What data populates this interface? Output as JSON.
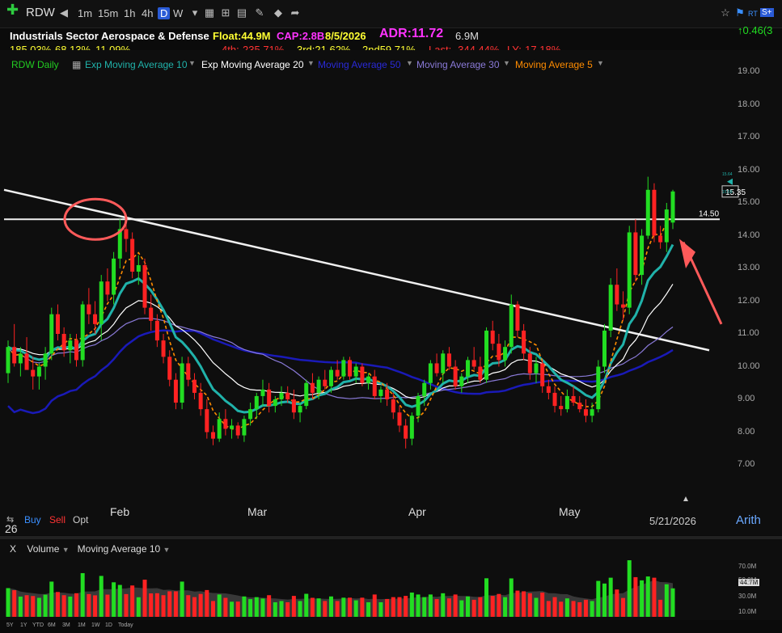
{
  "toolbar": {
    "symbol": "RDW",
    "intervals": [
      "1m",
      "15m",
      "1h",
      "4h",
      "D",
      "W"
    ],
    "selected_interval": "D",
    "right_change": "0.46(3",
    "rt_label": "RT",
    "s_label": "S+"
  },
  "info": {
    "sector": "Industrials Sector",
    "industry": "Aerospace & Defense",
    "float": "Float:44.9M",
    "cap": "CAP:2.8B",
    "earnings_date": "8/5/2026",
    "adr": "ADR:11.72",
    "avg_vol": "6.9M",
    "perf1": "185.03%",
    "perf2": "68.13%",
    "perf3": "11.09%",
    "q4": "4th:-235.71%",
    "q3": "3rd:21.62%",
    "q2": "2nd59.71%",
    "last": "Last: -344.44%",
    "ly": "LY:-17.18%"
  },
  "legend": {
    "daily": "RDW Daily",
    "ema10": "Exp Moving Average 10",
    "ema20": "Exp Moving Average 20",
    "ma50": "Moving Average 50",
    "ma30": "Moving Average 30",
    "ma5": "Moving Average 5"
  },
  "colors": {
    "up": "#22dd22",
    "down": "#ff2222",
    "ema10": "#20b2aa",
    "ema20": "#ffffff",
    "ma50": "#1a1ab8",
    "ma30": "#8a7ad8",
    "ma5": "#ff8c00",
    "daily": "#22cc22"
  },
  "chart_data": {
    "type": "candlestick",
    "y_ticks": [
      "19.00",
      "18.00",
      "17.00",
      "16.00",
      "15.00",
      "14.00",
      "13.00",
      "12.00",
      "11.00",
      "10.00",
      "9.00",
      "8.00",
      "7.00"
    ],
    "ylim": [
      6.5,
      19.5
    ],
    "x_ticks": [
      "Feb",
      "Mar",
      "Apr",
      "May"
    ],
    "date_label": "5/21/2026",
    "last_price": "15.35",
    "horizontal_line_label": "14.50",
    "horizontal_line_value": 14.5,
    "small_labels": [
      "15.64",
      "15.59"
    ],
    "candles": [
      [
        9.8,
        10.8,
        9.5,
        10.6
      ],
      [
        10.6,
        11.3,
        10.0,
        10.1
      ],
      [
        10.1,
        10.6,
        9.7,
        10.4
      ],
      [
        10.4,
        10.9,
        10.0,
        9.9
      ],
      [
        9.9,
        10.3,
        9.3,
        9.7
      ],
      [
        9.7,
        10.1,
        9.3,
        10.0
      ],
      [
        10.0,
        10.6,
        9.6,
        10.4
      ],
      [
        10.4,
        11.8,
        10.2,
        11.6
      ],
      [
        11.6,
        11.9,
        10.8,
        11.0
      ],
      [
        11.0,
        11.2,
        10.3,
        10.5
      ],
      [
        10.5,
        11.0,
        10.1,
        10.8
      ],
      [
        10.8,
        11.0,
        10.0,
        10.2
      ],
      [
        10.2,
        12.0,
        10.0,
        11.9
      ],
      [
        11.9,
        12.4,
        11.3,
        11.6
      ],
      [
        11.6,
        12.0,
        11.0,
        11.3
      ],
      [
        11.3,
        12.8,
        10.8,
        12.6
      ],
      [
        12.6,
        13.0,
        12.0,
        12.2
      ],
      [
        12.2,
        13.5,
        11.9,
        13.3
      ],
      [
        13.3,
        14.5,
        13.0,
        14.2
      ],
      [
        14.2,
        14.6,
        13.5,
        13.9
      ],
      [
        13.9,
        14.1,
        12.7,
        12.9
      ],
      [
        12.9,
        13.4,
        12.5,
        13.1
      ],
      [
        13.1,
        13.3,
        11.6,
        11.8
      ],
      [
        11.8,
        12.2,
        11.1,
        11.4
      ],
      [
        11.4,
        11.6,
        10.6,
        10.8
      ],
      [
        10.8,
        11.0,
        10.1,
        10.3
      ],
      [
        10.3,
        10.5,
        9.4,
        9.6
      ],
      [
        9.6,
        9.8,
        8.7,
        8.9
      ],
      [
        8.9,
        10.3,
        8.7,
        10.1
      ],
      [
        10.1,
        10.3,
        9.4,
        9.6
      ],
      [
        9.6,
        9.8,
        9.0,
        9.2
      ],
      [
        9.2,
        9.5,
        8.5,
        8.7
      ],
      [
        8.7,
        9.0,
        7.8,
        8.0
      ],
      [
        8.0,
        8.2,
        7.6,
        7.8
      ],
      [
        7.8,
        8.6,
        7.7,
        8.4
      ],
      [
        8.4,
        8.7,
        7.9,
        8.1
      ],
      [
        8.1,
        8.4,
        7.8,
        8.2
      ],
      [
        8.2,
        8.3,
        7.8,
        7.9
      ],
      [
        7.9,
        8.5,
        7.7,
        8.4
      ],
      [
        8.4,
        8.9,
        8.2,
        8.7
      ],
      [
        8.7,
        9.2,
        8.4,
        9.1
      ],
      [
        9.1,
        9.6,
        8.8,
        9.3
      ],
      [
        9.3,
        9.5,
        8.6,
        8.8
      ],
      [
        8.8,
        9.1,
        8.6,
        9.0
      ],
      [
        9.0,
        9.4,
        8.8,
        9.2
      ],
      [
        9.2,
        9.4,
        8.9,
        9.0
      ],
      [
        9.0,
        9.3,
        8.4,
        8.6
      ],
      [
        8.6,
        8.9,
        8.3,
        8.8
      ],
      [
        8.8,
        9.6,
        8.7,
        9.5
      ],
      [
        9.5,
        9.8,
        9.0,
        9.2
      ],
      [
        9.2,
        9.7,
        9.0,
        9.6
      ],
      [
        9.6,
        9.9,
        9.3,
        9.4
      ],
      [
        9.4,
        10.0,
        9.2,
        9.9
      ],
      [
        9.9,
        10.2,
        9.6,
        9.7
      ],
      [
        9.7,
        10.3,
        9.6,
        10.2
      ],
      [
        10.2,
        10.3,
        9.6,
        9.7
      ],
      [
        9.7,
        10.1,
        9.5,
        10.0
      ],
      [
        10.0,
        10.1,
        9.4,
        9.5
      ],
      [
        9.5,
        9.8,
        9.3,
        9.7
      ],
      [
        9.7,
        9.9,
        9.0,
        9.1
      ],
      [
        9.1,
        9.4,
        8.9,
        9.3
      ],
      [
        9.3,
        9.5,
        8.8,
        9.0
      ],
      [
        9.0,
        9.2,
        8.4,
        8.6
      ],
      [
        8.6,
        8.8,
        8.0,
        8.2
      ],
      [
        8.2,
        8.4,
        7.5,
        7.8
      ],
      [
        7.8,
        8.6,
        7.6,
        8.5
      ],
      [
        8.5,
        9.2,
        8.3,
        9.1
      ],
      [
        9.1,
        9.6,
        8.8,
        9.5
      ],
      [
        9.5,
        10.2,
        9.3,
        10.1
      ],
      [
        10.1,
        10.4,
        9.7,
        9.8
      ],
      [
        9.8,
        10.5,
        9.5,
        10.4
      ],
      [
        10.4,
        10.6,
        9.9,
        10.0
      ],
      [
        10.0,
        10.2,
        9.3,
        9.4
      ],
      [
        9.4,
        9.8,
        9.2,
        9.7
      ],
      [
        9.7,
        10.3,
        9.5,
        10.2
      ],
      [
        10.2,
        10.6,
        9.9,
        10.0
      ],
      [
        10.0,
        10.3,
        9.5,
        9.6
      ],
      [
        9.6,
        11.2,
        9.5,
        11.1
      ],
      [
        11.1,
        11.4,
        10.5,
        10.7
      ],
      [
        10.7,
        11.0,
        10.0,
        10.2
      ],
      [
        10.2,
        10.8,
        10.0,
        10.6
      ],
      [
        10.6,
        12.2,
        10.4,
        11.9
      ],
      [
        11.9,
        12.0,
        10.9,
        11.1
      ],
      [
        11.1,
        11.3,
        10.2,
        10.4
      ],
      [
        10.4,
        10.6,
        9.6,
        9.8
      ],
      [
        9.8,
        10.3,
        9.5,
        10.1
      ],
      [
        10.1,
        10.2,
        9.2,
        9.4
      ],
      [
        9.4,
        9.6,
        9.0,
        9.2
      ],
      [
        9.2,
        9.4,
        8.6,
        8.8
      ],
      [
        8.8,
        9.1,
        8.5,
        8.7
      ],
      [
        8.7,
        9.3,
        8.6,
        9.1
      ],
      [
        9.1,
        9.4,
        8.8,
        8.9
      ],
      [
        8.9,
        9.1,
        8.6,
        8.7
      ],
      [
        8.7,
        9.0,
        8.3,
        8.5
      ],
      [
        8.5,
        8.9,
        8.3,
        8.7
      ],
      [
        8.7,
        10.2,
        8.6,
        10.0
      ],
      [
        10.0,
        11.3,
        9.8,
        11.1
      ],
      [
        11.1,
        12.7,
        10.9,
        12.5
      ],
      [
        12.5,
        13.0,
        11.7,
        11.9
      ],
      [
        11.9,
        12.3,
        11.4,
        11.8
      ],
      [
        11.8,
        14.3,
        11.6,
        14.1
      ],
      [
        14.1,
        14.5,
        12.6,
        12.8
      ],
      [
        12.8,
        14.2,
        12.5,
        14.0
      ],
      [
        14.0,
        15.8,
        13.9,
        15.4
      ],
      [
        15.4,
        15.6,
        13.8,
        14.0
      ],
      [
        14.0,
        14.3,
        13.6,
        13.8
      ],
      [
        13.8,
        15.0,
        13.5,
        14.8
      ],
      [
        14.4,
        15.4,
        14.2,
        15.35
      ]
    ],
    "volume": {
      "y_ticks": [
        "70.0M",
        "50.0M",
        "30.0M",
        "10.0M"
      ],
      "current_label": "44.7M"
    }
  },
  "buttons": {
    "buy": "Buy",
    "sell": "Sell",
    "opt": "Opt",
    "arith": "Arith",
    "day": "26"
  },
  "volume_legend": {
    "volume": "Volume",
    "ma10": "Moving Average 10",
    "close": "X"
  },
  "ranges": [
    "5Y",
    "1Y",
    "YTD",
    "6M",
    "3M",
    "1M",
    "1W",
    "1D",
    "Today"
  ]
}
